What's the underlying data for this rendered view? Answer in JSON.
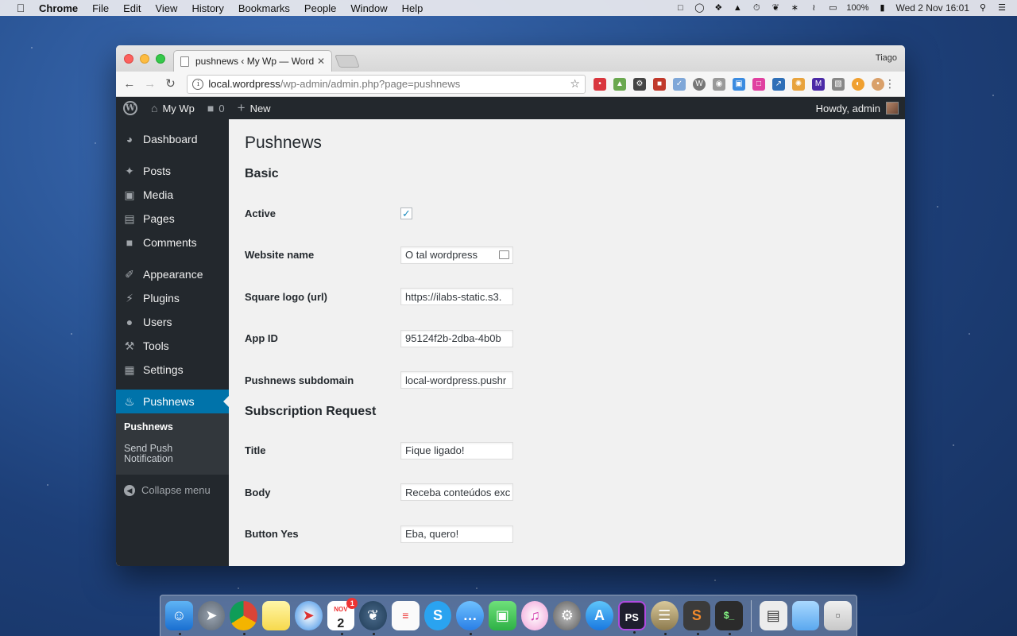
{
  "menubar": {
    "app": "Chrome",
    "items": [
      "File",
      "Edit",
      "View",
      "History",
      "Bookmarks",
      "People",
      "Window",
      "Help"
    ],
    "battery": "100%",
    "datetime": "Wed 2 Nov  16:01"
  },
  "browser": {
    "tab_title": "pushnews ‹ My Wp — WordPre",
    "profile": "Tiago",
    "url_host": "local.wordpress",
    "url_path": "/wp-admin/admin.php?page=pushnews"
  },
  "adminbar": {
    "site": "My Wp",
    "comments": "0",
    "new": "New",
    "howdy": "Howdy, admin"
  },
  "sidebar": {
    "items": [
      {
        "label": "Dashboard",
        "icon": "dashboard-icon"
      },
      {
        "label": "Posts",
        "icon": "pin-icon"
      },
      {
        "label": "Media",
        "icon": "media-icon"
      },
      {
        "label": "Pages",
        "icon": "pages-icon"
      },
      {
        "label": "Comments",
        "icon": "comment-icon"
      },
      {
        "label": "Appearance",
        "icon": "brush-icon"
      },
      {
        "label": "Plugins",
        "icon": "plug-icon"
      },
      {
        "label": "Users",
        "icon": "user-icon"
      },
      {
        "label": "Tools",
        "icon": "wrench-icon"
      },
      {
        "label": "Settings",
        "icon": "settings-icon"
      },
      {
        "label": "Pushnews",
        "icon": "bell-icon"
      }
    ],
    "submenu": [
      "Pushnews",
      "Send Push Notification"
    ],
    "collapse": "Collapse menu"
  },
  "page": {
    "title": "Pushnews",
    "section_basic": "Basic",
    "section_subscription": "Subscription Request",
    "fields": {
      "active_label": "Active",
      "website_name_label": "Website name",
      "website_name_value": "O tal wordpress",
      "logo_label": "Square logo (url)",
      "logo_value": "https://ilabs-static.s3.",
      "appid_label": "App ID",
      "appid_value": "95124f2b-2dba-4b0b",
      "subdomain_label": "Pushnews subdomain",
      "subdomain_value": "local-wordpress.pushr",
      "title_label": "Title",
      "title_value": "Fique ligado!",
      "body_label": "Body",
      "body_value": "Receba conteúdos exc",
      "button_yes_label": "Button Yes",
      "button_yes_value": "Eba, quero!"
    }
  },
  "dock": {
    "calendar_month": "NOV",
    "calendar_day": "2",
    "calendar_badge": "1",
    "ps_label": "PS"
  }
}
